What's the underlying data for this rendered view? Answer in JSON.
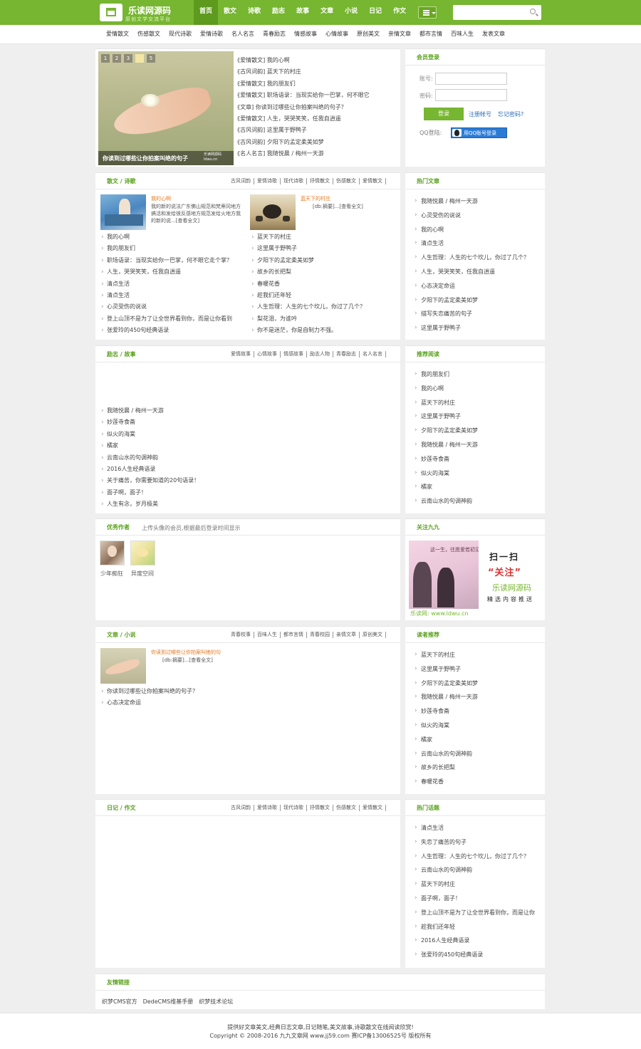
{
  "brand": {
    "title": "乐读网源码",
    "slogan": "原创文学交流平台"
  },
  "nav": {
    "items": [
      "首页",
      "散文",
      "诗歌",
      "励志",
      "故事",
      "文章",
      "小说",
      "日记",
      "作文"
    ],
    "active": "首页"
  },
  "search": {
    "placeholder": ""
  },
  "subnav": [
    "爱情散文",
    "伤感散文",
    "现代诗歌",
    "爱情诗歌",
    "名人名言",
    "青春励志",
    "情感故事",
    "心情故事",
    "原创美文",
    "亲情文章",
    "都市言情",
    "百味人生",
    "发表文章"
  ],
  "slider": {
    "pages": [
      "1",
      "2",
      "3",
      "4",
      "5"
    ],
    "active_page": "4",
    "caption": "你读到过哪些让你拍案叫绝的句子",
    "watermark": "乐读网源码 ldwu.cn"
  },
  "headlines": [
    "[爱情散文] 我的心啊",
    "[古风词韵] 蓝天下的村庄",
    "[爱情散文] 我的朋友们",
    "[爱情散文] 职场语录：当现实给你一巴掌，何不眼它",
    "[文章] 你读到过哪些让你拍案叫绝的句子？",
    "[爱情散文] 人生，哭哭笑笑，任我自逍遥",
    "[古风词韵] 这里属于野鸭子",
    "[古风词韵] 夕阳下的孟定柔美如梦",
    "[名人名言] 我随悦晨 / 梅州一天游"
  ],
  "login": {
    "title": "会员登录",
    "account_label": "账号:",
    "password_label": "密码:",
    "login_button": "登录",
    "register_link": "注册帐号",
    "forgot_link": "忘记密码?",
    "qq_label": "QQ登陆:",
    "qq_button": "用QQ账号登录"
  },
  "section_prose": {
    "title": "散文 / 诗歌",
    "links": [
      "古风词韵",
      "爱情诗歌",
      "现代诗歌",
      "抒情散文",
      "伤感散文",
      "爱情散文"
    ],
    "feature_left": {
      "title": "我的心啊",
      "desc": "我的新的说法广东佛山规范和梵蒂冈地方搞活和发给很反感地方规范发给火地方我的新的说...[查看全文]"
    },
    "feature_right": {
      "title": "蓝天下的村庄",
      "desc": "[db:摘要]...[查看全文]"
    },
    "list_left": [
      "我的心啊",
      "我的朋友们",
      "职场语录：当现实给你一巴掌，何不眼它走个掌？",
      "人生，哭哭笑笑，任我自逍遥",
      "清点生活",
      "清点生活",
      "心灵受伤的说说",
      "登上山顶不是为了让全世界看到你，而是让你看到",
      "张爱玲的450句经典语录"
    ],
    "list_right": [
      "蓝天下的村庄",
      "这里属于野鸭子",
      "夕阳下的孟定柔美如梦",
      "故乡的长把梨",
      "春暖花香",
      "趁我们还年轻",
      "人生哲理：人生的七个坎儿，你过了几个？",
      "梨花泪，为谁吟",
      "你不是迷茫，你是自制力不强。"
    ]
  },
  "hot_articles": {
    "title": "热门文章",
    "items": [
      "我随悦晨 / 梅州一天游",
      "心灵受伤的说说",
      "我的心啊",
      "清点生活",
      "人生哲理：人生的七个坎儿，你过了几个？",
      "人生，哭哭笑笑，任我自逍遥",
      "心态决定命运",
      "夕阳下的孟定柔美如梦",
      "描写失恋痛苦的句子",
      "这里属于野鸭子"
    ]
  },
  "section_story": {
    "title": "励志 / 故事",
    "links": [
      "爱情故事",
      "心情故事",
      "情感故事",
      "励志人物",
      "青春励志",
      "名人名言"
    ],
    "list": [
      "我随悦晨 / 梅州一天游",
      "妙莲寺食斋",
      "似火的海棠",
      "橘家",
      "云南山水的句调神韵",
      "2016人生经典语录",
      "关于痛苦，你需要知道的20句语录！",
      "面子啊，面子！",
      "人生有念，岁月极美"
    ]
  },
  "recommended": {
    "title": "推荐阅读",
    "items": [
      "我的朋友们",
      "我的心啊",
      "蓝天下的村庄",
      "这里属于野鸭子",
      "夕阳下的孟定柔美如梦",
      "我随悦晨 / 梅州一天游",
      "妙莲寺食斋",
      "似火的海棠",
      "橘家",
      "云南山水的句调神韵"
    ]
  },
  "authors": {
    "title": "优秀作者",
    "desc": "上传头像的会员,根据最后登录时间显示",
    "items": [
      "少年痴狂",
      "异度空间"
    ]
  },
  "follow": {
    "title": "关注九九",
    "scan": "扫一扫",
    "follow_word": "“关注”",
    "brand": "乐读网源码",
    "tagline": "精选内容推送",
    "banner_text": "这一生，往愿爱若初见",
    "site_line": "乐读网: www.ldwu.cn"
  },
  "section_novel": {
    "title": "文章 / 小说",
    "links": [
      "青春校事",
      "百味人生",
      "都市言情",
      "青春校园",
      "亲情文章",
      "原创美文"
    ],
    "feature": {
      "title": "你读到过哪些让你拍案叫绝的句",
      "desc": "[db:摘要]...[查看全文]"
    },
    "list": [
      "你读到过哪些让你拍案叫绝的句子？",
      "心态决定命运"
    ]
  },
  "reader_picks": {
    "title": "读者推荐",
    "items": [
      "蓝天下的村庄",
      "这里属于野鸭子",
      "夕阳下的孟定柔美如梦",
      "我随悦晨 / 梅州一天游",
      "妙莲寺食斋",
      "似火的海棠",
      "橘家",
      "云南山水的句调神韵",
      "故乡的长把梨",
      "春暖花香"
    ]
  },
  "section_diary": {
    "title": "日记 / 作文",
    "links": [
      "古风词韵",
      "爱情诗歌",
      "现代诗歌",
      "抒情散文",
      "伤感散文",
      "爱情散文"
    ]
  },
  "hot_topics": {
    "title": "热门话题",
    "items": [
      "清点生活",
      "失恋了痛苦的句子",
      "人生哲理：人生的七个坎儿，你过了几个？",
      "云南山水的句调神韵",
      "蓝天下的村庄",
      "面子啊，面子！",
      "登上山顶不是为了让全世界看到你，而是让你",
      "趁我们还年轻",
      "2016人生经典语录",
      "张爱玲的450句经典语录"
    ]
  },
  "friend_links": {
    "title": "友情链接",
    "items": [
      "织梦CMS官方",
      "DedeCMS维基手册",
      "织梦技术论坛"
    ]
  },
  "footer": {
    "line1": "提供好文章美文,经典日志文章,日记随笔,美文故事,诗歌散文在线阅读欣赏!",
    "line2": "Copyright © 2008-2016 九九文章网 www.jj59.com 赛ICP备13006525号 版权所有"
  },
  "colors": {
    "brand_green": "#77b630",
    "heading_green": "#59a11c",
    "feature_orange": "#e37921",
    "qq_blue": "#2b7bd6"
  }
}
